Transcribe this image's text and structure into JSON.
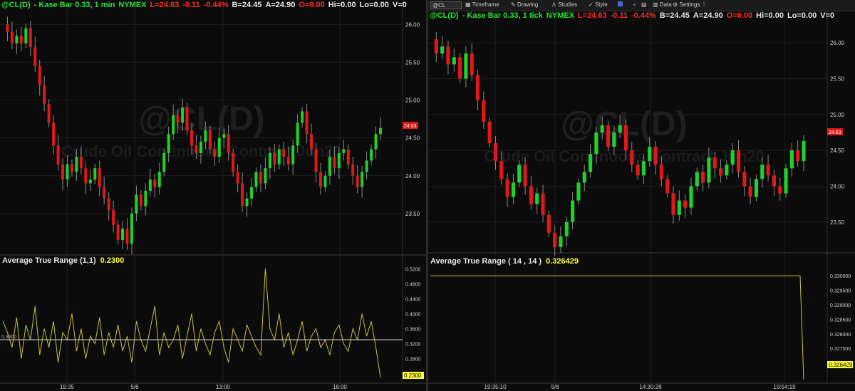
{
  "left": {
    "header": {
      "symbol": "@CL(D)",
      "study": "- Kase Bar 0.33, 1 min",
      "exchange": "NYMEX",
      "last": "L=24.63",
      "change": "-0.11",
      "change_pct": "-0.44%",
      "bid": "B=24.45",
      "ask": "A=24.90",
      "open": "O=0.00",
      "high": "Hi=0.00",
      "low": "Lo=0.00",
      "volume": "V=0"
    },
    "watermark": "@CL(D)",
    "watermark_sub": "Crude Oil Continuous Contract Jun20",
    "price_axis": [
      "26.00",
      "25.50",
      "25.00",
      "24.50",
      "24.00",
      "23.50"
    ],
    "last_price_tag": "24.63",
    "indicator": {
      "name": "Average True Range (1,1)",
      "value": "0.2300"
    },
    "indicator_axis": [
      "0.5200",
      "0.4800",
      "0.4400",
      "0.4000",
      "0.3600",
      "0.3200",
      "0.2800"
    ],
    "indicator_ref_label": "0.3300",
    "indicator_tag": "0.2300",
    "time_axis": [
      "19:35",
      "5/8",
      "13:00",
      "18:00"
    ]
  },
  "right": {
    "toolbar": {
      "symbol": "@CL",
      "items": [
        "Timeframe",
        "Drawing",
        "Studies",
        "Style",
        "Data",
        "Settings"
      ]
    },
    "header": {
      "symbol": "@CL(D)",
      "study": "- Kase Bar 0.33, 1 tick",
      "exchange": "NYMEX",
      "last": "L=24.63",
      "change": "-0.11",
      "change_pct": "-0.44%",
      "bid": "B=24.45",
      "ask": "A=24.90",
      "open": "O=0.00",
      "high": "Hi=0.00",
      "low": "Lo=0.00",
      "volume": "V=0"
    },
    "watermark": "@CL(D)",
    "watermark_sub": "Crude Oil Continuous Contract Jun20",
    "price_axis": [
      "26.00",
      "25.50",
      "25.00",
      "24.50",
      "24.00",
      "23.50"
    ],
    "last_price_tag": "24.63",
    "indicator": {
      "name": "Average True Range ( 14 , 14 )",
      "value": "0.326429"
    },
    "indicator_axis": [
      "0.330000",
      "0.329500",
      "0.329000",
      "0.328500",
      "0.328000",
      "0.327500",
      "0.327000"
    ],
    "indicator_tag": "0.326429",
    "time_axis": [
      "19:35:10",
      "5/8",
      "14:30:28",
      "19:54:19"
    ]
  },
  "colors": {
    "up": "#1ed12b",
    "down": "#e01818",
    "indicator_line": "#c8c040",
    "value_tag_bg": "#ffff33",
    "price_tag_bg": "#e01818"
  },
  "chart_data": [
    {
      "type": "candlestick",
      "title": "@CL(D) - Kase Bar 0.33, 1 min",
      "ylim": [
        23.0,
        26.2
      ],
      "closes": [
        26.0,
        25.9,
        25.75,
        25.85,
        25.75,
        25.95,
        25.7,
        25.45,
        25.2,
        24.95,
        24.7,
        24.4,
        24.15,
        23.95,
        24.15,
        24.05,
        24.25,
        24.1,
        23.9,
        23.95,
        24.1,
        23.85,
        23.7,
        23.55,
        23.35,
        23.15,
        23.3,
        23.1,
        23.5,
        23.75,
        23.6,
        23.8,
        23.95,
        23.85,
        24.05,
        24.3,
        24.55,
        24.8,
        24.7,
        24.9,
        24.6,
        24.4,
        24.3,
        24.45,
        24.6,
        24.35,
        24.25,
        24.5,
        24.55,
        24.3,
        24.05,
        23.9,
        23.6,
        23.7,
        23.85,
        24.05,
        23.9,
        24.1,
        24.3,
        24.15,
        24.35,
        24.25,
        24.15,
        24.4,
        24.7,
        24.85,
        24.55,
        24.35,
        24.05,
        23.85,
        24.0,
        24.25,
        24.1,
        24.3,
        24.35,
        24.15,
        24.0,
        23.85,
        24.05,
        24.2,
        24.35,
        24.55,
        24.63
      ]
    },
    {
      "type": "line",
      "title": "Average True Range (1,1)",
      "ylim": [
        0.23,
        0.53
      ],
      "values": [
        0.38,
        0.35,
        0.31,
        0.39,
        0.28,
        0.37,
        0.33,
        0.42,
        0.29,
        0.36,
        0.31,
        0.38,
        0.27,
        0.35,
        0.33,
        0.4,
        0.3,
        0.36,
        0.28,
        0.34,
        0.32,
        0.39,
        0.29,
        0.35,
        0.31,
        0.37,
        0.3,
        0.34,
        0.27,
        0.38,
        0.33,
        0.3,
        0.36,
        0.42,
        0.29,
        0.35,
        0.31,
        0.33,
        0.37,
        0.28,
        0.34,
        0.4,
        0.3,
        0.36,
        0.32,
        0.29,
        0.35,
        0.38,
        0.31,
        0.27,
        0.36,
        0.33,
        0.3,
        0.37,
        0.34,
        0.31,
        0.29,
        0.52,
        0.36,
        0.33,
        0.4,
        0.31,
        0.35,
        0.29,
        0.33,
        0.38,
        0.3,
        0.34,
        0.36,
        0.31,
        0.33,
        0.29,
        0.35,
        0.37,
        0.32,
        0.3,
        0.36,
        0.33,
        0.4,
        0.34,
        0.38,
        0.31,
        0.23
      ]
    },
    {
      "type": "candlestick",
      "title": "@CL(D) - Kase Bar 0.33, 1 tick",
      "ylim": [
        23.1,
        26.3
      ],
      "closes": [
        26.05,
        25.85,
        25.95,
        25.7,
        25.8,
        25.5,
        25.85,
        25.55,
        25.2,
        24.9,
        24.6,
        24.35,
        24.1,
        23.85,
        24.05,
        24.3,
        24.0,
        23.75,
        23.9,
        23.6,
        23.35,
        23.15,
        23.3,
        23.5,
        23.8,
        24.05,
        24.2,
        24.45,
        24.75,
        24.85,
        24.55,
        24.75,
        24.85,
        24.5,
        24.3,
        24.15,
        24.35,
        24.55,
        24.3,
        24.1,
        23.9,
        23.6,
        23.8,
        23.7,
        24.0,
        24.2,
        24.05,
        24.4,
        24.25,
        24.15,
        24.3,
        24.5,
        24.2,
        24.0,
        23.85,
        24.1,
        24.3,
        24.15,
        24.0,
        23.9,
        24.25,
        24.5,
        24.35,
        24.63
      ]
    },
    {
      "type": "line",
      "title": "Average True Range ( 14 , 14 )",
      "ylim": [
        0.3265,
        0.3303
      ],
      "values": [
        0.33,
        0.33,
        0.33,
        0.33,
        0.33,
        0.33,
        0.33,
        0.33,
        0.33,
        0.33,
        0.33,
        0.33,
        0.33,
        0.326429
      ]
    }
  ]
}
